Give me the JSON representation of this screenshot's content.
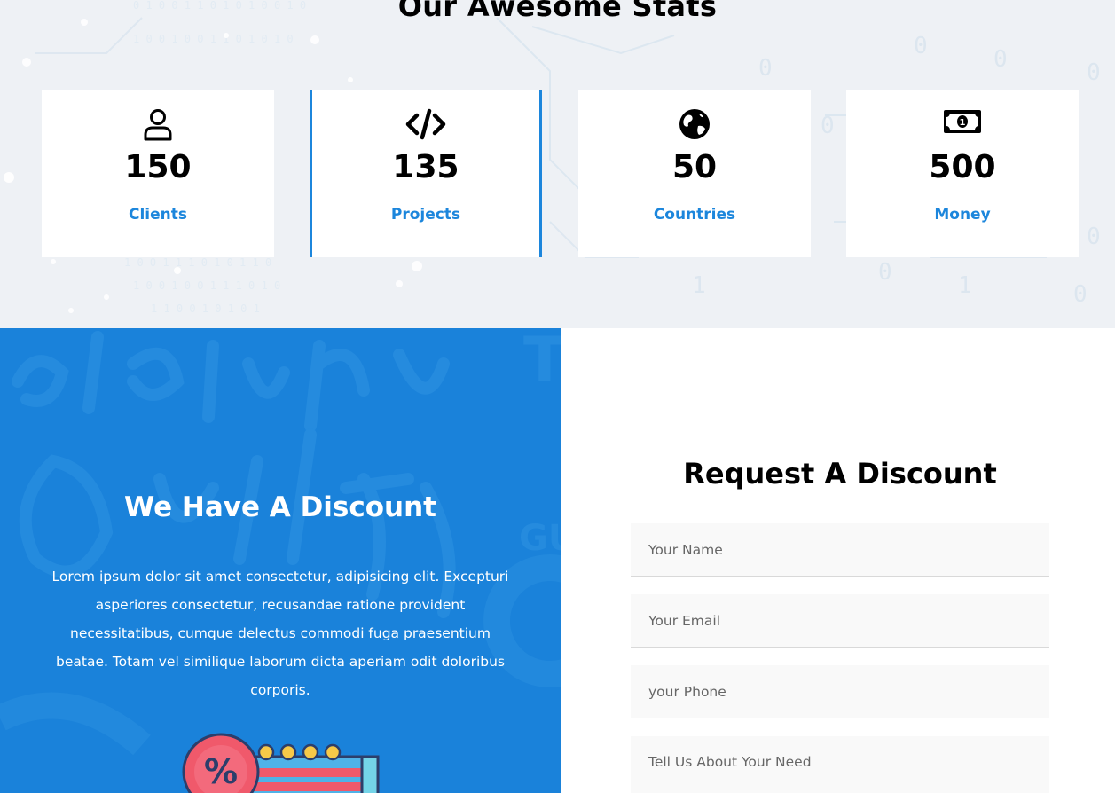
{
  "stats": {
    "title": "Our Awesome Stats",
    "cards": [
      {
        "icon": "user-icon",
        "value": "150",
        "label": "Clients"
      },
      {
        "icon": "code-icon",
        "value": "135",
        "label": "Projects"
      },
      {
        "icon": "globe-icon",
        "value": "50",
        "label": "Countries"
      },
      {
        "icon": "money-bill-icon",
        "value": "500",
        "label": "Money"
      }
    ]
  },
  "discount": {
    "title": "We Have A Discount",
    "text": "Lorem ipsum dolor sit amet consectetur, adipisicing elit. Excepturi asperiores consectetur, recusandae ratione provident necessitatibus, cumque delectus commodi fuga praesentium beatae. Totam vel similique laborum dicta aperiam odit doloribus corporis.",
    "illustration": "discount-percent-illustration"
  },
  "request": {
    "title": "Request A Discount",
    "name_placeholder": "Your Name",
    "email_placeholder": "Your Email",
    "phone_placeholder": "your Phone",
    "need_placeholder": "Tell Us About Your Need"
  },
  "colors": {
    "accent": "#1c86dc",
    "discount_bg": "#1a82da",
    "stats_bg": "#eef1f5",
    "field_bg": "#f9f9f9"
  }
}
